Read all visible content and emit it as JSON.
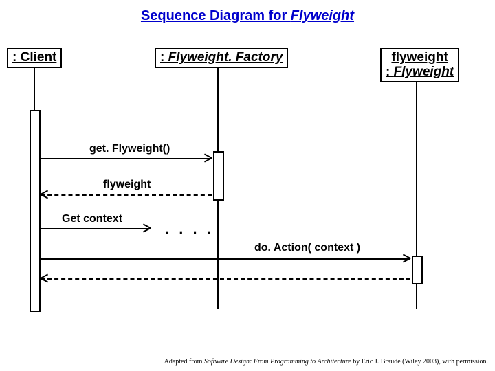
{
  "title_prefix": "Sequence Diagram for ",
  "title_subject": "Flyweight",
  "participants": {
    "client": ": Client",
    "factory_prefix": ": ",
    "factory_name": "Flyweight. Factory",
    "flyweight_obj": "flyweight",
    "flyweight_class_prefix": ": ",
    "flyweight_class": "Flyweight"
  },
  "messages": {
    "get_flyweight": "get. Flyweight()",
    "return_flyweight": "flyweight",
    "get_context": "Get context",
    "dots": ". . . .",
    "do_action": "do. Action( context )"
  },
  "attribution": {
    "prefix": "Adapted from ",
    "book": "Software Design: From Programming to Architecture",
    "suffix": " by Eric J. Braude (Wiley 2003), with permission."
  }
}
